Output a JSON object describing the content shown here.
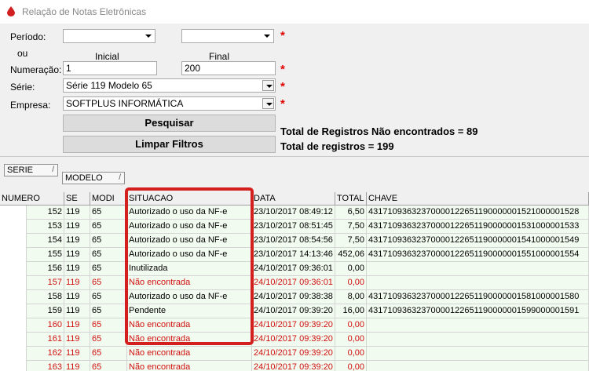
{
  "window": {
    "title": "Relação de Notas Eletrônicas"
  },
  "form": {
    "periodo_label": "Período:",
    "ou_label": "ou",
    "inicial_label": "Inicial",
    "final_label": "Final",
    "numeracao_label": "Numeração:",
    "serie_label": "Série:",
    "empresa_label": "Empresa:",
    "periodo_inicial": "",
    "periodo_final": "",
    "numeracao_inicial": "1",
    "numeracao_final": "200",
    "serie_value": "Série 119 Modelo 65",
    "empresa_value": "SOFTPLUS INFORMÁTICA",
    "required_mark": "*"
  },
  "buttons": {
    "pesquisar": "Pesquisar",
    "limpar": "Limpar Filtros"
  },
  "summary": {
    "nao_encontrados": "Total de Registros Não encontrados = 89",
    "total": "Total de registros = 199"
  },
  "grouping": {
    "serie": "SERIE",
    "modelo": "MODELO",
    "sort_glyph": "/"
  },
  "grid": {
    "headers": [
      "NUMERO",
      "SE",
      "MODI",
      "SITUACAO",
      "DATA",
      "TOTAL",
      "CHAVE"
    ],
    "rows": [
      {
        "numero": "152",
        "serie": "119",
        "modelo": "65",
        "situacao": "Autorizado o uso da NF-e",
        "data": "23/10/2017 08:49:12",
        "total": "6,50",
        "chave": "43171093632370000122651190000001521000001528",
        "status": "ok"
      },
      {
        "numero": "153",
        "serie": "119",
        "modelo": "65",
        "situacao": "Autorizado o uso da NF-e",
        "data": "23/10/2017 08:51:45",
        "total": "7,50",
        "chave": "43171093632370000122651190000001531000001533",
        "status": "ok"
      },
      {
        "numero": "154",
        "serie": "119",
        "modelo": "65",
        "situacao": "Autorizado o uso da NF-e",
        "data": "23/10/2017 08:54:56",
        "total": "7,50",
        "chave": "43171093632370000122651190000001541000001549",
        "status": "ok"
      },
      {
        "numero": "155",
        "serie": "119",
        "modelo": "65",
        "situacao": "Autorizado o uso da NF-e",
        "data": "23/10/2017 14:13:46",
        "total": "452,06",
        "chave": "43171093632370000122651190000001551000001554",
        "status": "ok"
      },
      {
        "numero": "156",
        "serie": "119",
        "modelo": "65",
        "situacao": "Inutilizada",
        "data": "24/10/2017 09:36:01",
        "total": "0,00",
        "chave": "",
        "status": "ok"
      },
      {
        "numero": "157",
        "serie": "119",
        "modelo": "65",
        "situacao": "Não encontrada",
        "data": "24/10/2017 09:36:01",
        "total": "0,00",
        "chave": "",
        "status": "missing"
      },
      {
        "numero": "158",
        "serie": "119",
        "modelo": "65",
        "situacao": "Autorizado o uso da NF-e",
        "data": "24/10/2017 09:38:38",
        "total": "8,00",
        "chave": "43171093632370000122651190000001581000001580",
        "status": "ok"
      },
      {
        "numero": "159",
        "serie": "119",
        "modelo": "65",
        "situacao": "Pendente",
        "data": "24/10/2017 09:39:20",
        "total": "16,00",
        "chave": "43171093632370000122651190000001599000001591",
        "status": "ok"
      },
      {
        "numero": "160",
        "serie": "119",
        "modelo": "65",
        "situacao": "Não encontrada",
        "data": "24/10/2017 09:39:20",
        "total": "0,00",
        "chave": "",
        "status": "missing"
      },
      {
        "numero": "161",
        "serie": "119",
        "modelo": "65",
        "situacao": "Não encontrada",
        "data": "24/10/2017 09:39:20",
        "total": "0,00",
        "chave": "",
        "status": "missing"
      },
      {
        "numero": "162",
        "serie": "119",
        "modelo": "65",
        "situacao": "Não encontrada",
        "data": "24/10/2017 09:39:20",
        "total": "0,00",
        "chave": "",
        "status": "missing"
      },
      {
        "numero": "163",
        "serie": "119",
        "modelo": "65",
        "situacao": "Não encontrada",
        "data": "24/10/2017 09:39:20",
        "total": "0,00",
        "chave": "",
        "status": "missing"
      }
    ]
  },
  "colors": {
    "missing_text": "#d01010",
    "highlight_border": "#d41f1f",
    "required": "#e00000",
    "row_bg": "#f2fbef"
  }
}
